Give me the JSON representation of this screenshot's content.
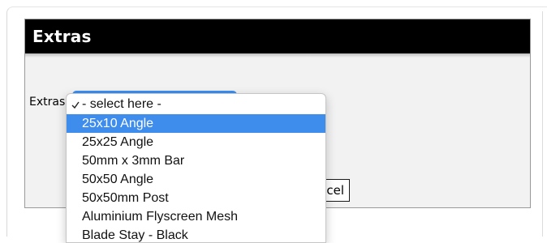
{
  "panel": {
    "title": "Extras"
  },
  "form": {
    "field_label": "Extras",
    "cancel_button_label": "cel"
  },
  "dropdown": {
    "selected_value": "- select here -",
    "highlighted_index": 1,
    "options": [
      {
        "label": "- select here -",
        "checked": true
      },
      {
        "label": "25x10 Angle",
        "checked": false
      },
      {
        "label": "25x25 Angle",
        "checked": false
      },
      {
        "label": "50mm x 3mm Bar",
        "checked": false
      },
      {
        "label": "50x50 Angle",
        "checked": false
      },
      {
        "label": "50x50mm Post",
        "checked": false
      },
      {
        "label": "Aluminium Flyscreen Mesh",
        "checked": false
      },
      {
        "label": "Blade Stay - Black",
        "checked": false
      }
    ]
  },
  "colors": {
    "header_background": "#000000",
    "highlight": "#3e8ded",
    "panel_background": "#f2f2f2"
  }
}
